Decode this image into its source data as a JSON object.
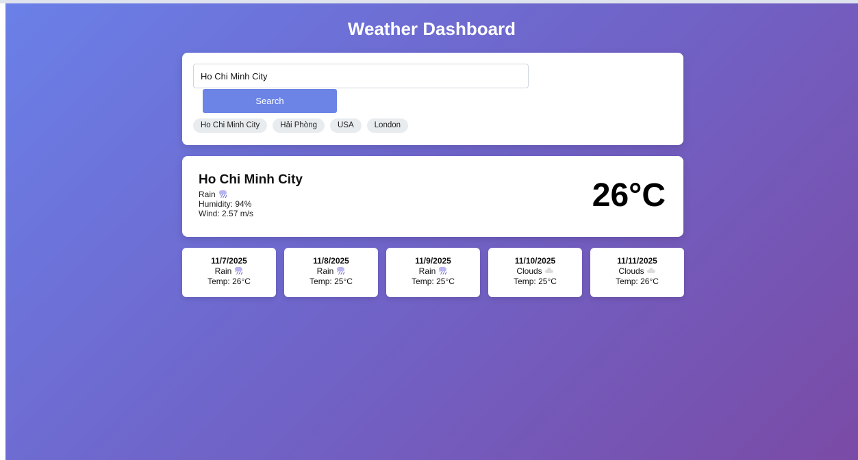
{
  "page": {
    "title": "Weather Dashboard"
  },
  "search": {
    "value": "Ho Chi Minh City",
    "button_label": "Search",
    "chips": [
      "Ho Chi Minh City",
      "Hải Phòng",
      "USA",
      "London"
    ]
  },
  "current": {
    "city": "Ho Chi Minh City",
    "condition": "Rain",
    "condition_icon": "rain-icon",
    "humidity": "Humidity: 94%",
    "wind": "Wind: 2.57 m/s",
    "temperature": "26°C"
  },
  "forecast": [
    {
      "date": "11/7/2025",
      "condition": "Rain",
      "icon": "rain-icon",
      "temp": "Temp: 26°C"
    },
    {
      "date": "11/8/2025",
      "condition": "Rain",
      "icon": "rain-icon",
      "temp": "Temp: 25°C"
    },
    {
      "date": "11/9/2025",
      "condition": "Rain",
      "icon": "rain-icon",
      "temp": "Temp: 25°C"
    },
    {
      "date": "11/10/2025",
      "condition": "Clouds",
      "icon": "cloud-icon",
      "temp": "Temp: 25°C"
    },
    {
      "date": "11/11/2025",
      "condition": "Clouds",
      "icon": "cloud-icon",
      "temp": "Temp: 26°C"
    }
  ],
  "colors": {
    "gradient_start": "#6a80e8",
    "gradient_end": "#7a4ba6",
    "button": "#6b84e6",
    "chip_bg": "#e9ecef"
  }
}
